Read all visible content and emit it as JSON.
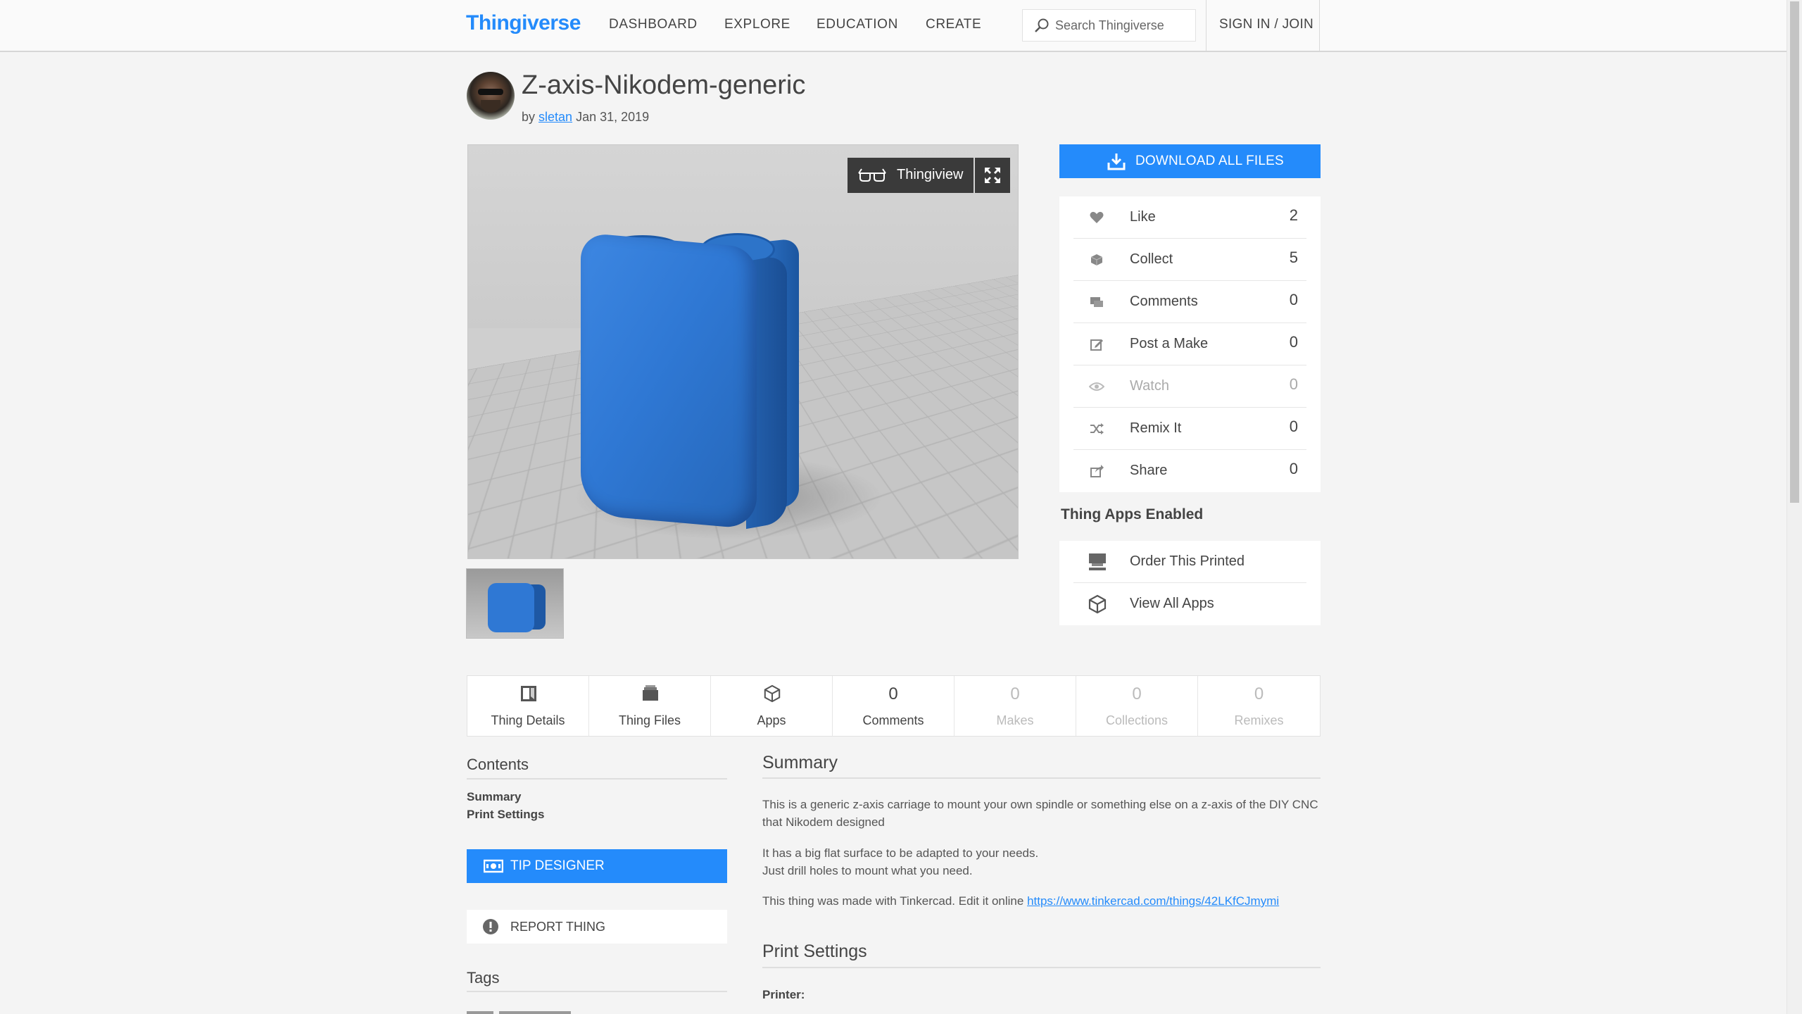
{
  "header": {
    "logo": "Thingiverse",
    "nav": [
      "DASHBOARD",
      "EXPLORE",
      "EDUCATION",
      "CREATE"
    ],
    "search_placeholder": "Search Thingiverse",
    "signin": "SIGN IN / JOIN"
  },
  "thing": {
    "title": "Z-axis-Nikodem-generic",
    "by": "by",
    "author": "sletan",
    "date": "Jan 31, 2019"
  },
  "viewer": {
    "thingview_label": "Thingiview",
    "icons": {
      "thingview": "3d-glasses-icon",
      "fullscreen": "expand-icon"
    },
    "model_color": "#2f78d4"
  },
  "actions": {
    "download_label": "DOWNLOAD ALL FILES",
    "stats": [
      {
        "label": "Like",
        "count": "2",
        "icon": "heart-icon"
      },
      {
        "label": "Collect",
        "count": "5",
        "icon": "collect-icon"
      },
      {
        "label": "Comments",
        "count": "0",
        "icon": "comment-icon"
      },
      {
        "label": "Post a Make",
        "count": "0",
        "icon": "edit-icon"
      },
      {
        "label": "Watch",
        "count": "0",
        "icon": "eye-icon"
      },
      {
        "label": "Remix It",
        "count": "0",
        "icon": "shuffle-icon"
      },
      {
        "label": "Share",
        "count": "0",
        "icon": "share-icon"
      }
    ]
  },
  "apps": {
    "heading": "Thing Apps Enabled",
    "items": [
      {
        "label": "Order This Printed",
        "icon": "printer-icon"
      },
      {
        "label": "View All Apps",
        "icon": "cube-icon"
      }
    ]
  },
  "tabs": [
    {
      "label": "Thing Details",
      "count": "",
      "icon": "details-icon"
    },
    {
      "label": "Thing Files",
      "count": "",
      "icon": "files-icon"
    },
    {
      "label": "Apps",
      "count": "",
      "icon": "cube-icon"
    },
    {
      "label": "Comments",
      "count": "0"
    },
    {
      "label": "Makes",
      "count": "0"
    },
    {
      "label": "Collections",
      "count": "0"
    },
    {
      "label": "Remixes",
      "count": "0"
    }
  ],
  "sidebar": {
    "contents_heading": "Contents",
    "links": [
      "Summary",
      "Print Settings"
    ],
    "tip_label": "TIP DESIGNER",
    "report_label": "REPORT THING",
    "tags_heading": "Tags"
  },
  "summary": {
    "heading": "Summary",
    "p1": "This is a generic z-axis carriage to mount your own spindle or something else on a z-axis of the DIY CNC that Nikodem designed",
    "p2a": "It has a big flat surface to be adapted to your needs.",
    "p2b": "Just drill holes to mount what you need.",
    "p3": "This thing was made with Tinkercad. Edit it online",
    "link": "https://www.tinkercad.com/things/42LKfCJmymi"
  },
  "print_settings": {
    "heading": "Print Settings",
    "printer_label": "Printer:"
  },
  "colors": {
    "accent": "#248bfb",
    "background": "#f4f4f4"
  }
}
